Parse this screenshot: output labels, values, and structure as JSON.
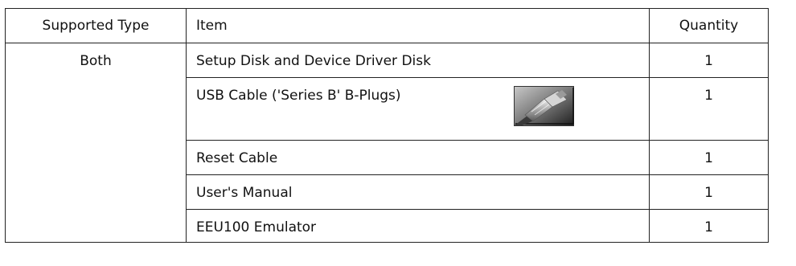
{
  "table": {
    "headers": [
      "Supported Type",
      "Item",
      "Quantity"
    ],
    "supported_type": "Both",
    "rows": [
      {
        "item": "Setup Disk and Device Driver Disk",
        "quantity": "1"
      },
      {
        "item": "USB Cable ('Series B' B-Plugs)",
        "quantity": "1",
        "icon": "usb-cable-icon"
      },
      {
        "item": "Reset Cable",
        "quantity": "1"
      },
      {
        "item": "User's Manual",
        "quantity": "1"
      },
      {
        "item": "EEU100 Emulator",
        "quantity": "1"
      }
    ]
  }
}
